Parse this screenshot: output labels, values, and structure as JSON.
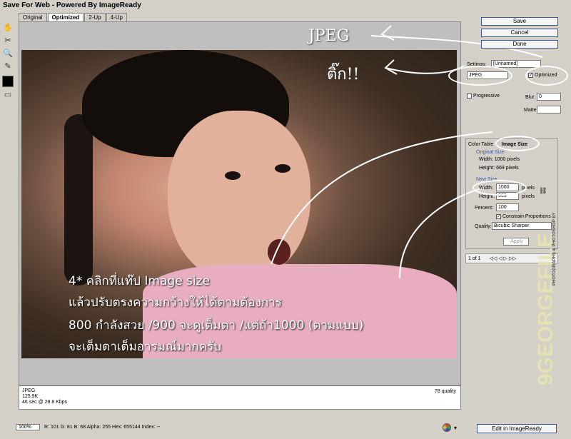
{
  "title": "Save For Web - Powered By ImageReady",
  "tabs": [
    "Original",
    "Optimized",
    "2-Up",
    "4-Up"
  ],
  "buttons": {
    "save": "Save",
    "cancel": "Cancel",
    "done": "Done",
    "apply": "Apply",
    "edit": "Edit in ImageReady"
  },
  "settings": {
    "preset_label": "Settings:",
    "preset_value": "[Unnamed]",
    "format": "JPEG",
    "optimized_label": "Optimized",
    "progressive_label": "Progressive",
    "blur_label": "Blur:",
    "blur_value": "0",
    "matte_label": "Matte:"
  },
  "panel_tabs": {
    "color_table": "Color Table",
    "image_size": "Image Size"
  },
  "image_size": {
    "original_label": "Original Size",
    "original_width": "Width: 1000 pixels",
    "original_height": "Height: 669 pixels",
    "new_label": "New Size",
    "width_label": "Width:",
    "width_value": "1000",
    "height_label": "Height:",
    "height_value": "669",
    "pixels": "pixels",
    "percent_label": "Percent:",
    "percent_value": "100",
    "constrain_label": "Constrain Proportions",
    "quality_label": "Quality:",
    "quality_value": "Bicubic Sharper"
  },
  "nav": {
    "page": "1 of 1"
  },
  "status": {
    "format": "JPEG",
    "size": "125.9K",
    "time": "46 sec @ 28.8 Kbps",
    "quality": "78 quality"
  },
  "bottom": {
    "zoom": "100%",
    "readout": "R:  101    G:  81    B:  68    Alpha:  255    Hex:  655144    Index:  --"
  },
  "annotations": {
    "jpeg_note": "JPEG",
    "tick_note": "ติ๊ก!!",
    "line1": "4* คลิกที่แท๊ป Image size",
    "line2": "แล้วปรับตรงความกว้างให้ได้ตามต้องการ",
    "line3": "800 กำลังสวย /900 จะดูเต็มตา /แต่ถ้า1000 (ตามแบบ)",
    "line4": "จะเต็มตาเต็มอารมณ์มากครับ"
  },
  "watermark": {
    "main": "9GEORGEFILE",
    "small": "PHOTOGRAPHS & PHOTOSHOP BY"
  },
  "colors": {
    "button_border": "#3a5aa0",
    "panel_bg": "#d4d0c8",
    "photo_bg": "#3e2e22"
  }
}
